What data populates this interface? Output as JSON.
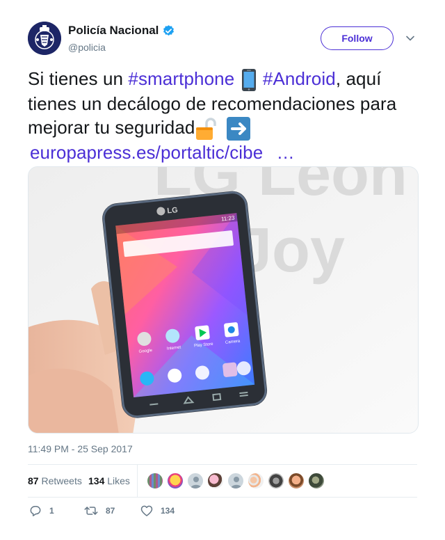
{
  "tweet": {
    "author": {
      "display_name": "Policía Nacional",
      "handle": "@policia",
      "verified": true,
      "avatar_icon": "police-emblem-icon"
    },
    "follow_label": "Follow",
    "text": {
      "part1": "Si tienes un ",
      "hashtag1": "#smartphone",
      "emoji1": "mobile-phone-icon",
      "hashtag2": "#Android",
      "part2": ", aquí tienes un decálogo de recomendaciones para mejorar tu seguridad",
      "emoji2": "unlocked-padlock-icon",
      "emoji3": "right-arrow-icon",
      "link": "europapress.es/portaltic/cibe",
      "ellipsis": "…"
    },
    "media": {
      "icon": "lg-smartphone-photo",
      "brand_text": "LG",
      "phone_time": "11:23",
      "app_labels": [
        "Google",
        "Internet",
        "Play Store",
        "Camera"
      ]
    },
    "timestamp": "11:49 PM - 25 Sep 2017",
    "stats": {
      "retweets_count": "87",
      "retweets_label": "Retweets",
      "likes_count": "134",
      "likes_label": "Likes"
    },
    "actions": {
      "reply_count": "1",
      "retweet_count": "87",
      "like_count": "134"
    },
    "colors": {
      "accent": "#4b2fd6",
      "verified": "#1da1f2",
      "muted_text": "#657786"
    }
  }
}
